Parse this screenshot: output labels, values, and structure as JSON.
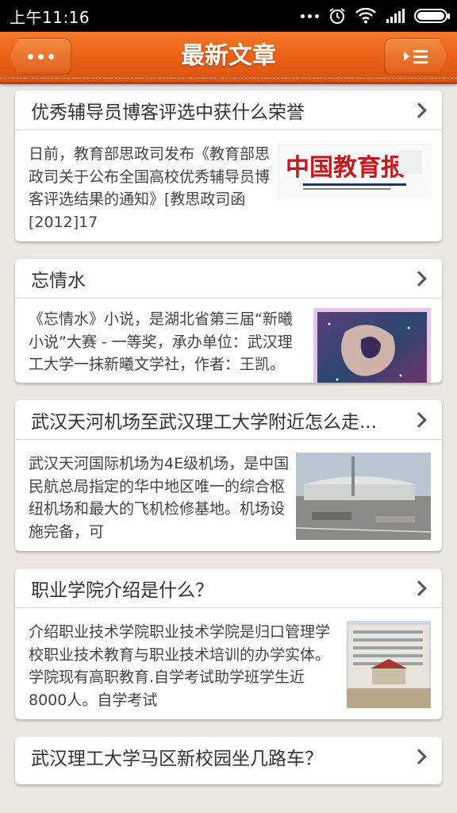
{
  "status_bar": {
    "time": "上午11:16"
  },
  "app_bar": {
    "title": "最新文章",
    "left_icon": "more-dots-icon",
    "right_icon": "menu-list-icon"
  },
  "articles": [
    {
      "title": "优秀辅导员博客评选中获什么荣誉",
      "summary": "日前，教育部思政司发布《教育部思政司关于公布全国高校优秀辅导员博客评选结果的通知》[教思政司函[2012]17",
      "thumb_logo_text": "中国教育报"
    },
    {
      "title": "忘情水",
      "summary": "《忘情水》小说，是湖北省第三届“新曦小说”大赛 - 一等奖，承办单位：武汉理工大学一抹新曦文学社，作者：王凯。"
    },
    {
      "title": "武汉天河机场至武汉理工大学附近怎么走...",
      "summary": "武汉天河国际机场为4E级机场，是中国民航总局指定的华中地区唯一的综合枢纽机场和最大的飞机检修基地。机场设施完备，可"
    },
    {
      "title": "职业学院介绍是什么？",
      "summary": "介绍职业技术学院职业技术学院是归口管理学校职业技术教育与职业技术培训的办学实体。学院现有高职教育.自学考试助学班学生近8000人。自学考试"
    },
    {
      "title": "武汉理工大学马区新校园坐几路车？"
    }
  ]
}
